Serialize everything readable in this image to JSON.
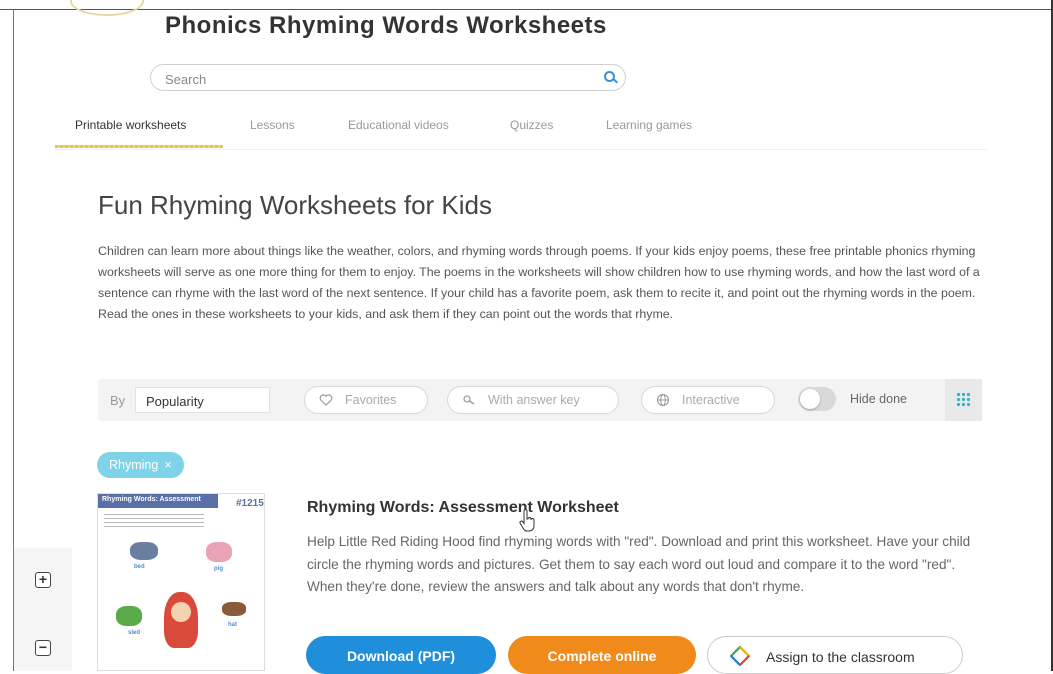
{
  "site": {
    "title": "Phonics Rhyming Words Worksheets"
  },
  "search": {
    "placeholder": "Search"
  },
  "tabs": [
    {
      "label": "Printable worksheets",
      "active": true
    },
    {
      "label": "Lessons"
    },
    {
      "label": "Educational videos"
    },
    {
      "label": "Quizzes"
    },
    {
      "label": "Learning games"
    }
  ],
  "main": {
    "heading": "Fun Rhyming Worksheets for Kids",
    "description": "Children can learn more about things like the weather, colors, and rhyming words through poems. If your kids enjoy poems, these free printable phonics rhyming worksheets will serve as one more thing for them to enjoy. The poems in the worksheets will show children how to use rhyming words, and how the last word of a sentence can rhyme with the last word of the next sentence. If your child has a favorite poem, ask them to recite it, and point out the rhyming words in the poem. Read the ones in these worksheets to your kids, and ask them if they can point out the words that rhyme."
  },
  "filters": {
    "by_label": "By",
    "sort_value": "Popularity",
    "favorites": "Favorites",
    "answer_key": "With answer key",
    "interactive": "Interactive",
    "hide_done": "Hide done",
    "hide_done_on": false
  },
  "active_tag": {
    "label": "Rhyming",
    "remove": "×"
  },
  "worksheet": {
    "title": "Rhyming Words: Assessment Worksheet",
    "description": "Help Little Red Riding Hood find rhyming words with \"red\". Download and print this worksheet. Have your child circle the rhyming words and pictures. Get them to say each word out loud and compare it to the word \"red\". When they're done, review the answers and talk about any words that don't rhyme.",
    "thumbnail": {
      "header": "Rhyming Words: Assessment",
      "number": "#1215",
      "words": [
        "bed",
        "pig",
        "sled",
        "hat"
      ]
    },
    "buttons": {
      "download": "Download (PDF)",
      "complete": "Complete online",
      "assign": "Assign to the classroom"
    }
  },
  "zoom": {
    "in": "+",
    "out": "−"
  },
  "colors": {
    "accent_blue": "#1f8fdc",
    "accent_orange": "#f08a1a",
    "tag_blue": "#7ed3e8",
    "tab_underline": "#e6c34a"
  }
}
